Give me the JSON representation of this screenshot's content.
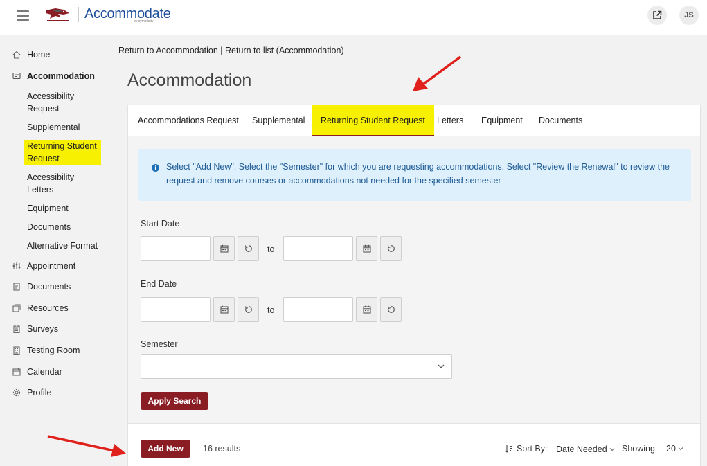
{
  "header": {
    "brand": "Accommodate",
    "brand_sub": "by symplicity",
    "avatar_initials": "JS",
    "accent_color": "#8a1c24",
    "brand_color": "#1e4e9c"
  },
  "sidebar": {
    "items": [
      {
        "label": "Home",
        "icon": "home-icon"
      },
      {
        "label": "Accommodation",
        "icon": "accommodation-icon"
      },
      {
        "label": "Appointment",
        "icon": "appointment-icon"
      },
      {
        "label": "Documents",
        "icon": "documents-icon"
      },
      {
        "label": "Resources",
        "icon": "resources-icon"
      },
      {
        "label": "Surveys",
        "icon": "surveys-icon"
      },
      {
        "label": "Testing Room",
        "icon": "testing-room-icon"
      },
      {
        "label": "Calendar",
        "icon": "calendar-icon"
      },
      {
        "label": "Profile",
        "icon": "profile-icon"
      }
    ],
    "accommodation_sub": [
      {
        "line1": "Accessibility",
        "line2": "Request"
      },
      {
        "line1": "Supplemental",
        "line2": ""
      },
      {
        "line1": "Returning Student",
        "line2": "Request"
      },
      {
        "line1": "Accessibility",
        "line2": "Letters"
      },
      {
        "line1": "Equipment",
        "line2": ""
      },
      {
        "line1": "Documents",
        "line2": ""
      },
      {
        "line1": "Alternative Format",
        "line2": ""
      }
    ],
    "highlight_color": "#f7f000"
  },
  "breadcrumb": {
    "link1": "Return to Accommodation",
    "separator": " | ",
    "link2": "Return to list (Accommodation)"
  },
  "page_title": "Accommodation",
  "tabs": [
    "Accommodations Request",
    "Supplemental",
    "Returning Student Request",
    "Letters",
    "Equipment",
    "Documents"
  ],
  "active_tab": "Returning Student Request",
  "info_text": "Select \"Add New\". Select the \"Semester\" for which you are requesting accommodations. Select \"Review the Renewal\" to review the request and remove courses or accommodations not needed for the specified semester",
  "form": {
    "start_date_label": "Start Date",
    "end_date_label": "End Date",
    "to_label": "to",
    "semester_label": "Semester",
    "start_from": "",
    "start_to": "",
    "end_from": "",
    "end_to": "",
    "semester_value": "",
    "apply_label": "Apply Search"
  },
  "results_bar": {
    "add_new_label": "Add New",
    "results_text": "16 results",
    "sort_by_label": "Sort By:",
    "sort_value": "Date Needed",
    "showing_label": "Showing",
    "showing_value": "20"
  },
  "annotation_color": "#e0201b"
}
